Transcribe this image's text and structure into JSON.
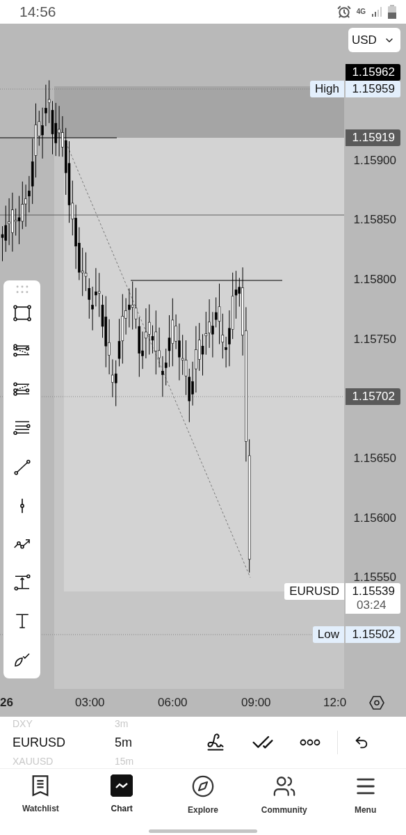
{
  "status_bar": {
    "time": "14:56",
    "network": "4G"
  },
  "currency_select": {
    "value": "USD"
  },
  "price_axis": {
    "ticks": [
      "1.15900",
      "1.15850",
      "1.15800",
      "1.15750",
      "1.15650",
      "1.15600",
      "1.15550"
    ]
  },
  "price_tags": [
    {
      "kind": "last",
      "value": "1.15962"
    },
    {
      "kind": "high",
      "label": "High",
      "value": "1.15959"
    },
    {
      "kind": "level",
      "value": "1.15919"
    },
    {
      "kind": "level",
      "value": "1.15702"
    },
    {
      "kind": "current",
      "label": "EURUSD",
      "value": "1.15539",
      "countdown": "03:24"
    },
    {
      "kind": "low",
      "label": "Low",
      "value": "1.15502"
    }
  ],
  "time_axis": {
    "labels": [
      {
        "text": "26",
        "kind": "date"
      },
      {
        "text": "03:00",
        "kind": "time"
      },
      {
        "text": "06:00",
        "kind": "time"
      },
      {
        "text": "09:00",
        "kind": "time"
      },
      {
        "text": "12:0",
        "kind": "time"
      }
    ]
  },
  "symbols": [
    {
      "symbol": "DXY",
      "interval": "3m",
      "selected": false
    },
    {
      "symbol": "EURUSD",
      "interval": "5m",
      "selected": true
    },
    {
      "symbol": "XAUUSD",
      "interval": "15m",
      "selected": false
    }
  ],
  "nav": [
    {
      "label": "Watchlist",
      "selected": false
    },
    {
      "label": "Chart",
      "selected": true
    },
    {
      "label": "Explore",
      "selected": false
    },
    {
      "label": "Community",
      "selected": false
    },
    {
      "label": "Menu",
      "selected": false
    }
  ]
}
